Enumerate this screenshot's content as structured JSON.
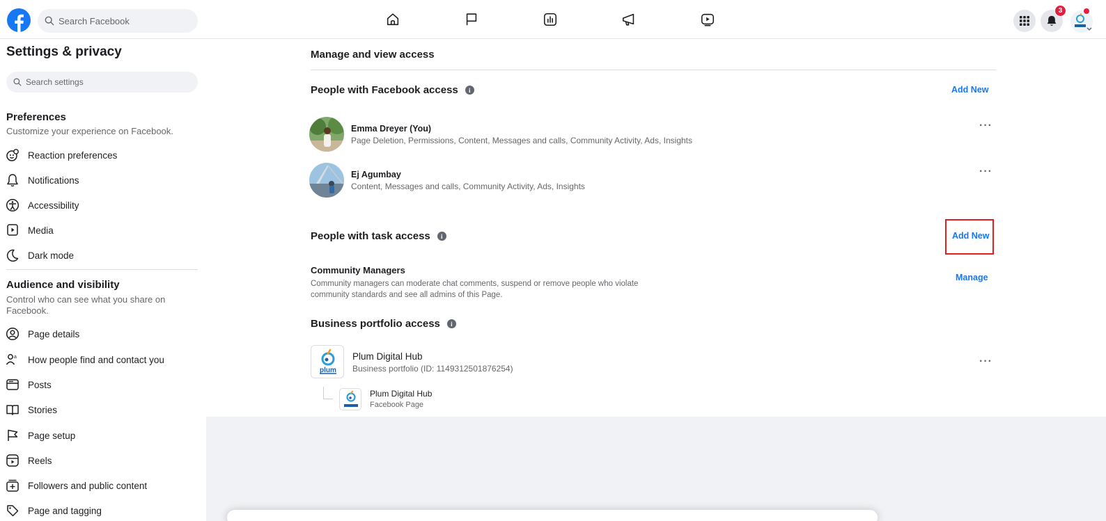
{
  "topbar": {
    "search_placeholder": "Search Facebook",
    "notification_count": "3",
    "nav_icons": [
      "home-icon",
      "flag-icon",
      "insights-icon",
      "megaphone-icon",
      "video-icon"
    ]
  },
  "sidebar": {
    "title": "Settings & privacy",
    "search_placeholder": "Search settings",
    "preferences": {
      "heading": "Preferences",
      "description": "Customize your experience on Facebook.",
      "items": [
        {
          "label": "Reaction preferences",
          "icon": "reaction-icon"
        },
        {
          "label": "Notifications",
          "icon": "bell-icon"
        },
        {
          "label": "Accessibility",
          "icon": "accessibility-icon"
        },
        {
          "label": "Media",
          "icon": "media-icon"
        },
        {
          "label": "Dark mode",
          "icon": "moon-icon"
        }
      ]
    },
    "audience": {
      "heading": "Audience and visibility",
      "description": "Control who can see what you share on Facebook.",
      "items": [
        {
          "label": "Page details",
          "icon": "page-details-icon"
        },
        {
          "label": "How people find and contact you",
          "icon": "people-icon"
        },
        {
          "label": "Posts",
          "icon": "posts-icon"
        },
        {
          "label": "Stories",
          "icon": "stories-icon"
        },
        {
          "label": "Page setup",
          "icon": "flag-icon"
        },
        {
          "label": "Reels",
          "icon": "reels-icon"
        },
        {
          "label": "Followers and public content",
          "icon": "followers-icon"
        },
        {
          "label": "Page and tagging",
          "icon": "tag-icon"
        }
      ]
    }
  },
  "main": {
    "title": "Manage and view access",
    "facebook_access": {
      "title": "People with Facebook access",
      "add_label": "Add New",
      "people": [
        {
          "name": "Emma Dreyer (You)",
          "permissions": "Page Deletion, Permissions, Content, Messages and calls, Community Activity, Ads, Insights"
        },
        {
          "name": "Ej Agumbay",
          "permissions": "Content, Messages and calls, Community Activity, Ads, Insights"
        }
      ]
    },
    "task_access": {
      "title": "People with task access",
      "add_label": "Add New",
      "role_name": "Community Managers",
      "role_description": "Community managers can moderate chat comments, suspend or remove people who violate community standards and see all admins of this Page.",
      "manage_label": "Manage"
    },
    "business_access": {
      "title": "Business portfolio access",
      "portfolio_name": "Plum Digital Hub",
      "portfolio_id": "Business portfolio (ID: 1149312501876254)",
      "page_name": "Plum Digital Hub",
      "page_type": "Facebook Page",
      "logo_text": "plum"
    },
    "more_label": "···"
  },
  "colors": {
    "accent": "#1877f2",
    "highlight": "#e02020",
    "badge": "#e41e3f"
  }
}
